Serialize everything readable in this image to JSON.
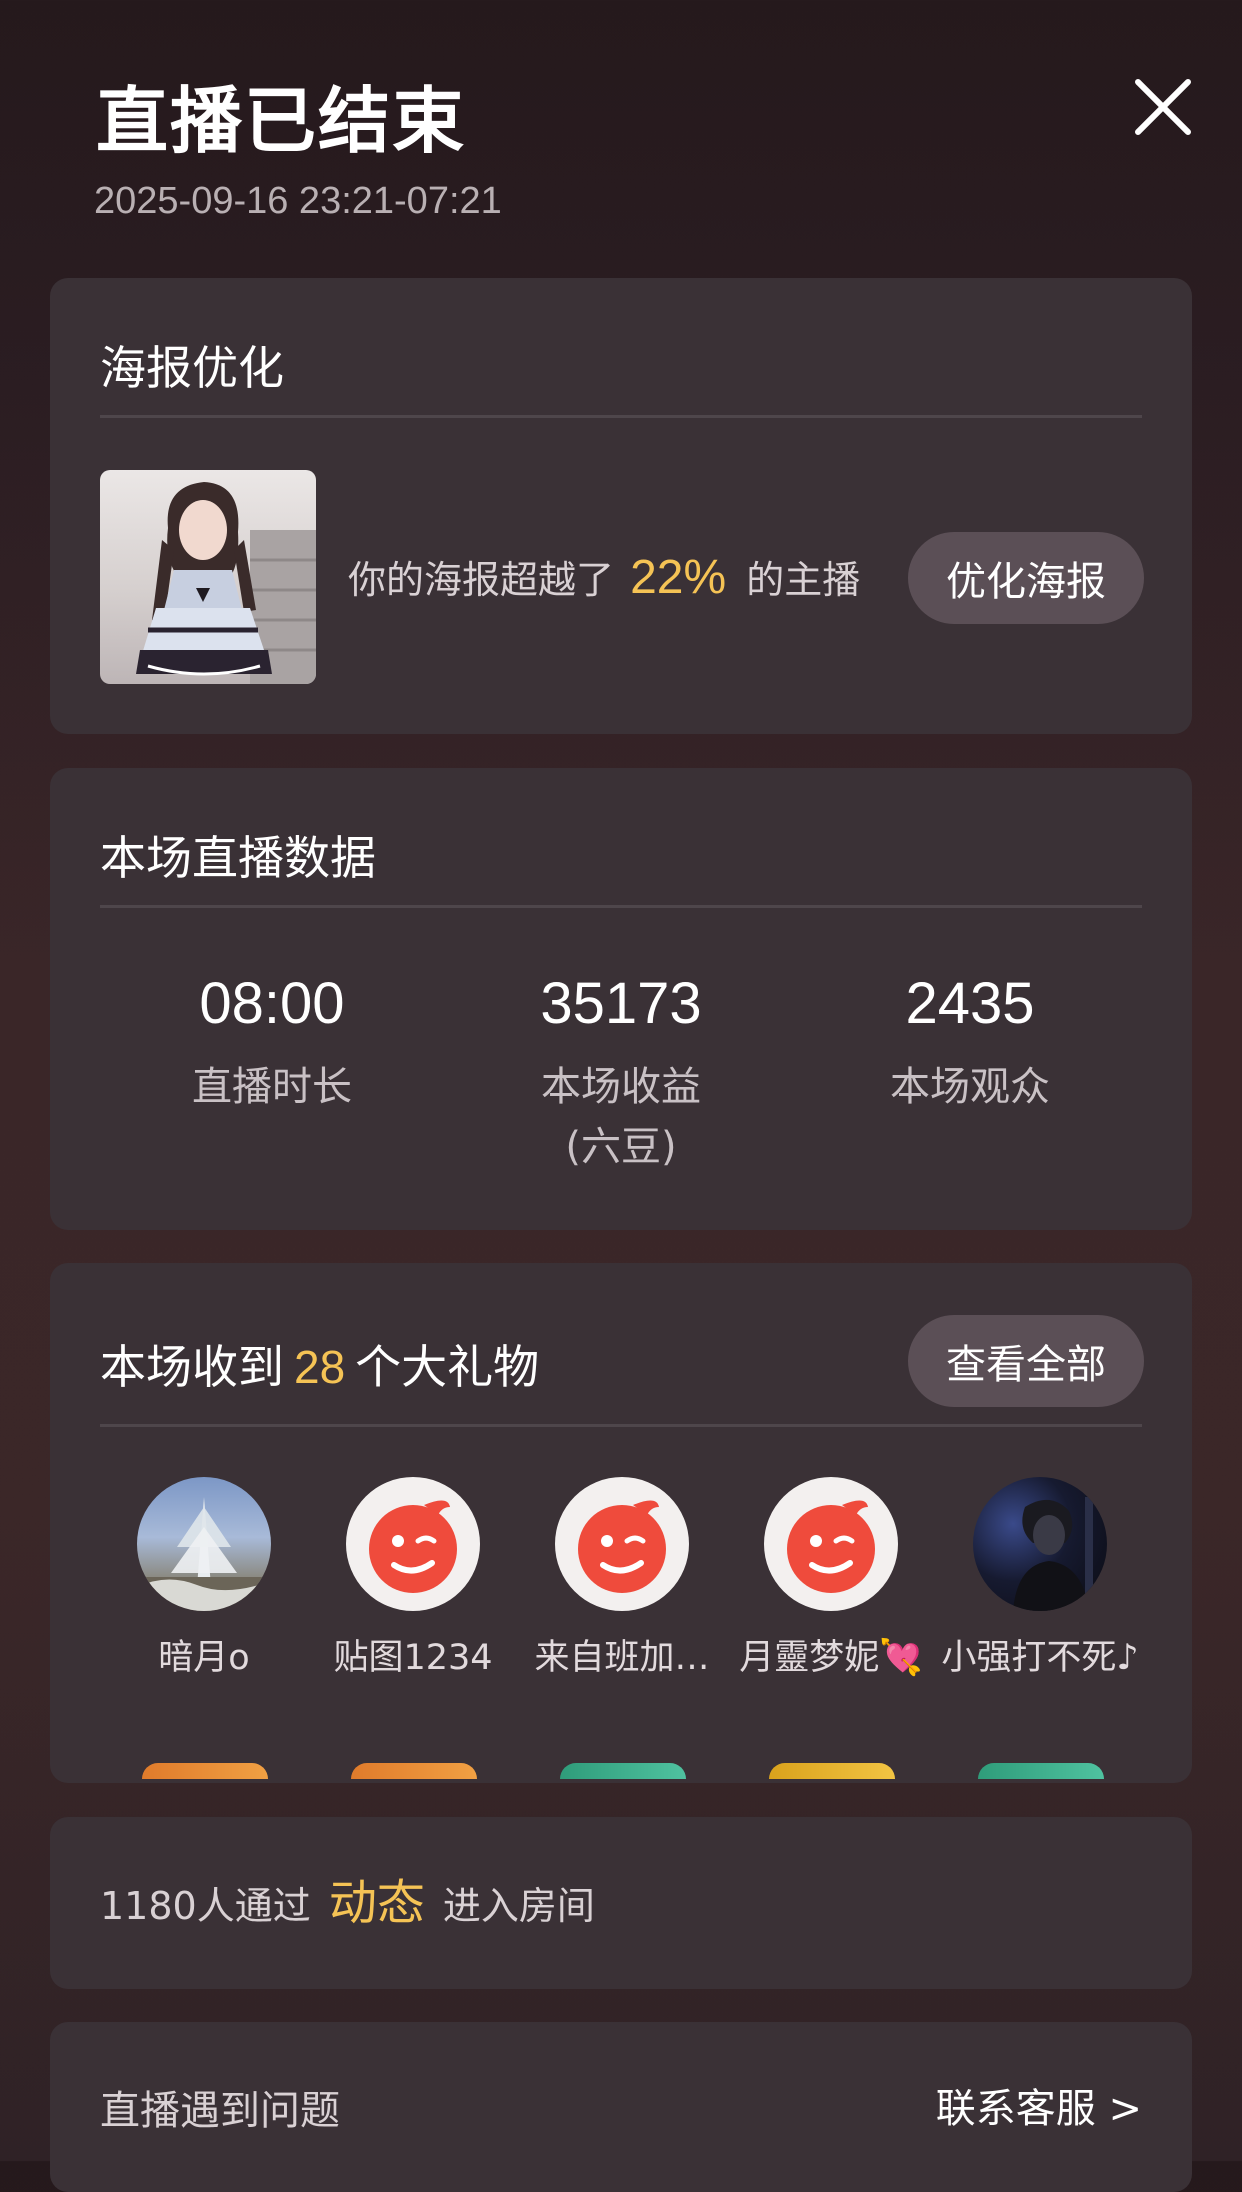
{
  "header": {
    "title": "直播已结束",
    "time_range": "2025-09-16 23:21-07:21"
  },
  "poster_section": {
    "title": "海报优化",
    "text_before": "你的海报超越了",
    "percent": "22%",
    "text_after": "的主播",
    "button_label": "优化海报"
  },
  "stats_section": {
    "title": "本场直播数据",
    "stats": [
      {
        "value": "08:00",
        "label": "直播时长",
        "sublabel": ""
      },
      {
        "value": "35173",
        "label": "本场收益",
        "sublabel": "(六豆)"
      },
      {
        "value": "2435",
        "label": "本场观众",
        "sublabel": ""
      }
    ]
  },
  "gifts_section": {
    "title_before": "本场收到",
    "count": "28",
    "title_after": "个大礼物",
    "button_label": "查看全部",
    "gifters": [
      {
        "name": "暗月o",
        "avatar": "snow-tree-photo"
      },
      {
        "name": "贴图1234",
        "avatar": "wink-face-logo"
      },
      {
        "name": "来自班加…",
        "avatar": "wink-face-logo"
      },
      {
        "name": "月靈梦妮💘",
        "avatar": "wink-face-logo"
      },
      {
        "name": "小强打不死♪",
        "avatar": "dark-portrait-photo"
      }
    ]
  },
  "dynamic_section": {
    "text_before": "1180人通过",
    "highlight": "动态",
    "text_after": "进入房间"
  },
  "problem_section": {
    "label": "直播遇到问题",
    "link_label": "联系客服 >"
  },
  "colors": {
    "accent": "#f5c355",
    "card_bg": "#3a3136",
    "button_bg": "#5b4f56",
    "logo_red": "#ef4b3c"
  }
}
